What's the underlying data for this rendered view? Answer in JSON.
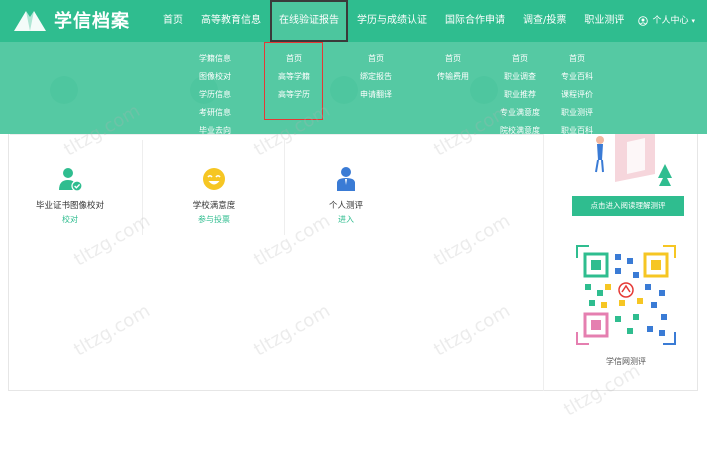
{
  "brand": {
    "name": "学信档案"
  },
  "nav": {
    "items": [
      {
        "label": "首页"
      },
      {
        "label": "高等教育信息"
      },
      {
        "label": "在线验证报告"
      },
      {
        "label": "学历与成绩认证"
      },
      {
        "label": "国际合作申请"
      },
      {
        "label": "调查/投票"
      },
      {
        "label": "职业测评"
      }
    ],
    "user_menu": "个人中心"
  },
  "dropdown": {
    "col1": [
      "学籍信息",
      "图像校对",
      "学历信息",
      "考研信息",
      "毕业去向"
    ],
    "col2": [
      "首页",
      "高等学籍",
      "高等学历"
    ],
    "col3": [
      "首页",
      "绑定报告",
      "申请翻译"
    ],
    "col4": [
      "首页",
      "传输费用"
    ],
    "col5": [
      "首页",
      "职业调查",
      "职业推荐",
      "专业满意度",
      "院校满意度"
    ],
    "col6": [
      "首页",
      "专业百科",
      "课程评价",
      "职业测评",
      "职业百科"
    ]
  },
  "tiles": [
    {
      "title": "毕业证书图像校对",
      "link": "校对"
    },
    {
      "title": "学校满意度",
      "link": "参与投票"
    },
    {
      "title": "个人测评",
      "link": "进入"
    }
  ],
  "right_panel": {
    "button": "点击进入阅读理解测评",
    "qr_caption": "学信网测评"
  },
  "watermark": "tltzg.com",
  "colors": {
    "brand": "#2fbd8f",
    "highlight": "#e53935"
  }
}
